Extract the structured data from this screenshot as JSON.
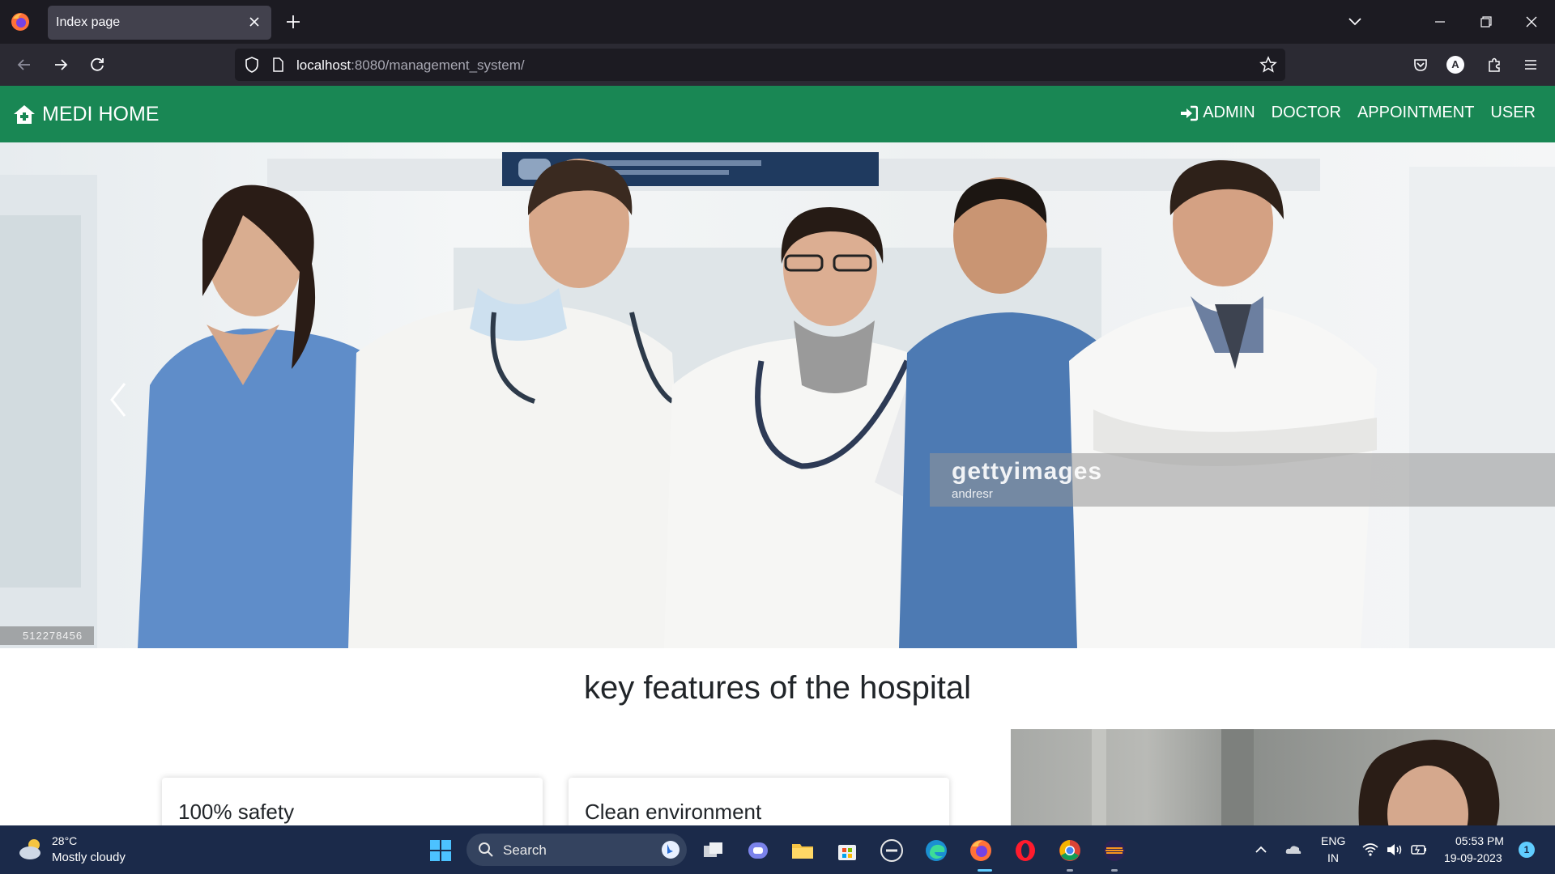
{
  "browser": {
    "tab_title": "Index page",
    "url_host": "localhost",
    "url_path": ":8080/management_system/",
    "profile_initial": "A"
  },
  "site": {
    "brand": "MEDI HOME",
    "menu": [
      "ADMIN",
      "DOCTOR",
      "APPOINTMENT",
      "USER"
    ],
    "accent_color": "#198754"
  },
  "hero": {
    "watermark_brand": "gettyimages",
    "watermark_credit": "andresr",
    "image_id": "512278456"
  },
  "features": {
    "heading": "key features of the hospital",
    "cards": [
      "100% safety",
      "Clean environment"
    ]
  },
  "taskbar": {
    "weather_temp": "28°C",
    "weather_desc": "Mostly cloudy",
    "search_label": "Search",
    "lang_line1": "ENG",
    "lang_line2": "IN",
    "time": "05:53 PM",
    "date": "19-09-2023",
    "notification_count": "1"
  }
}
